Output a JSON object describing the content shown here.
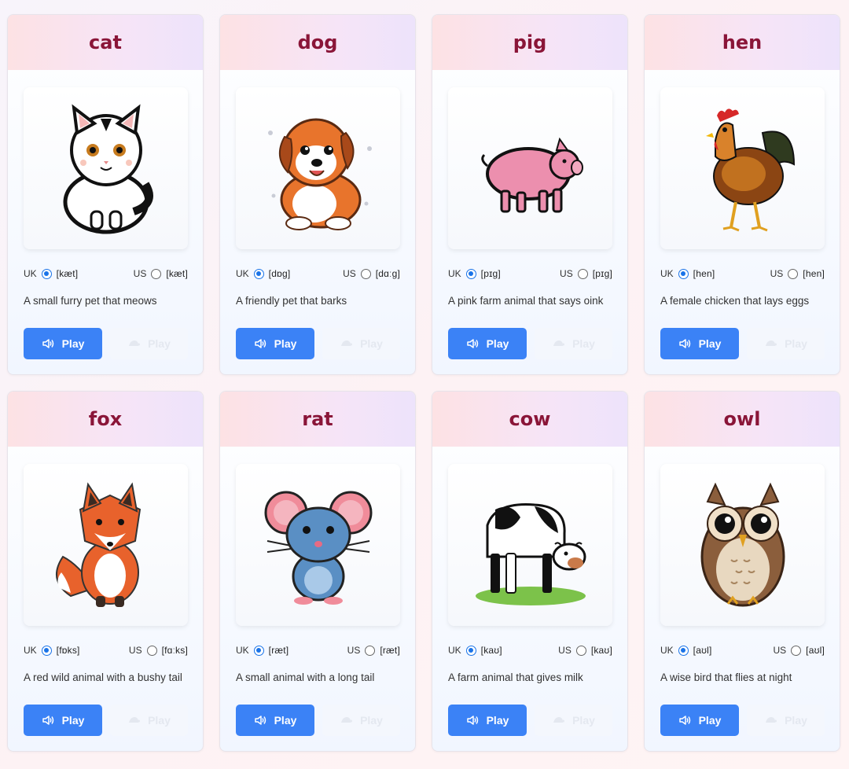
{
  "cards": [
    {
      "word": "cat",
      "uk_label": "UK",
      "uk_ipa": "[kæt]",
      "us_label": "US",
      "us_ipa": "[kæt]",
      "description": "A small furry pet that meows",
      "play_label": "Play",
      "slow_label": "Play"
    },
    {
      "word": "dog",
      "uk_label": "UK",
      "uk_ipa": "[dɒg]",
      "us_label": "US",
      "us_ipa": "[dɑːg]",
      "description": "A friendly pet that barks",
      "play_label": "Play",
      "slow_label": "Play"
    },
    {
      "word": "pig",
      "uk_label": "UK",
      "uk_ipa": "[pɪg]",
      "us_label": "US",
      "us_ipa": "[pɪg]",
      "description": "A pink farm animal that says oink",
      "play_label": "Play",
      "slow_label": "Play"
    },
    {
      "word": "hen",
      "uk_label": "UK",
      "uk_ipa": "[hen]",
      "us_label": "US",
      "us_ipa": "[hen]",
      "description": "A female chicken that lays eggs",
      "play_label": "Play",
      "slow_label": "Play"
    },
    {
      "word": "fox",
      "uk_label": "UK",
      "uk_ipa": "[fɒks]",
      "us_label": "US",
      "us_ipa": "[fɑːks]",
      "description": "A red wild animal with a bushy tail",
      "play_label": "Play",
      "slow_label": "Play"
    },
    {
      "word": "rat",
      "uk_label": "UK",
      "uk_ipa": "[ræt]",
      "us_label": "US",
      "us_ipa": "[ræt]",
      "description": "A small animal with a long tail",
      "play_label": "Play",
      "slow_label": "Play"
    },
    {
      "word": "cow",
      "uk_label": "UK",
      "uk_ipa": "[kaʊ]",
      "us_label": "US",
      "us_ipa": "[kaʊ]",
      "description": "A farm animal that gives milk",
      "play_label": "Play",
      "slow_label": "Play"
    },
    {
      "word": "owl",
      "uk_label": "UK",
      "uk_ipa": "[aʊl]",
      "us_label": "US",
      "us_ipa": "[aʊl]",
      "description": "A wise bird that flies at night",
      "play_label": "Play",
      "slow_label": "Play"
    }
  ],
  "selected_accent": "UK",
  "colors": {
    "accent": "#3b82f6",
    "word": "#8a1538",
    "radio_on": "#1a73e8"
  },
  "icons": {
    "play": "speaker-icon",
    "slow": "turtle-icon"
  }
}
